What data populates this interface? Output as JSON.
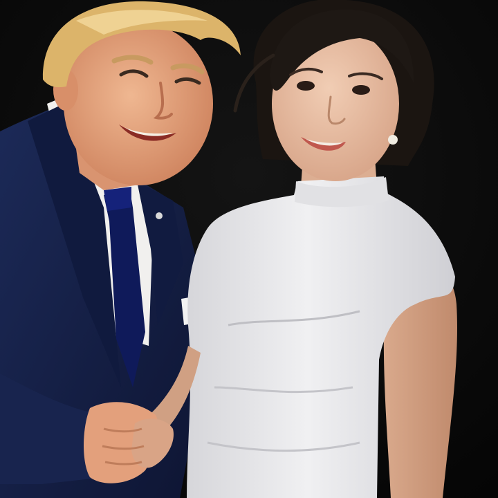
{
  "photo": {
    "subjects": [
      "man-in-navy-suit",
      "woman-in-white-top"
    ],
    "background_color": "#070707",
    "colors": {
      "suit": "#16224a",
      "tie": "#0f1a5a",
      "shirt": "#f1f0ee",
      "skin_man": "#e6a37e",
      "hair_man": "#dcb46a",
      "skin_woman": "#e8bfa4",
      "hair_woman": "#1b1511",
      "top": "#e8e8ea"
    }
  }
}
